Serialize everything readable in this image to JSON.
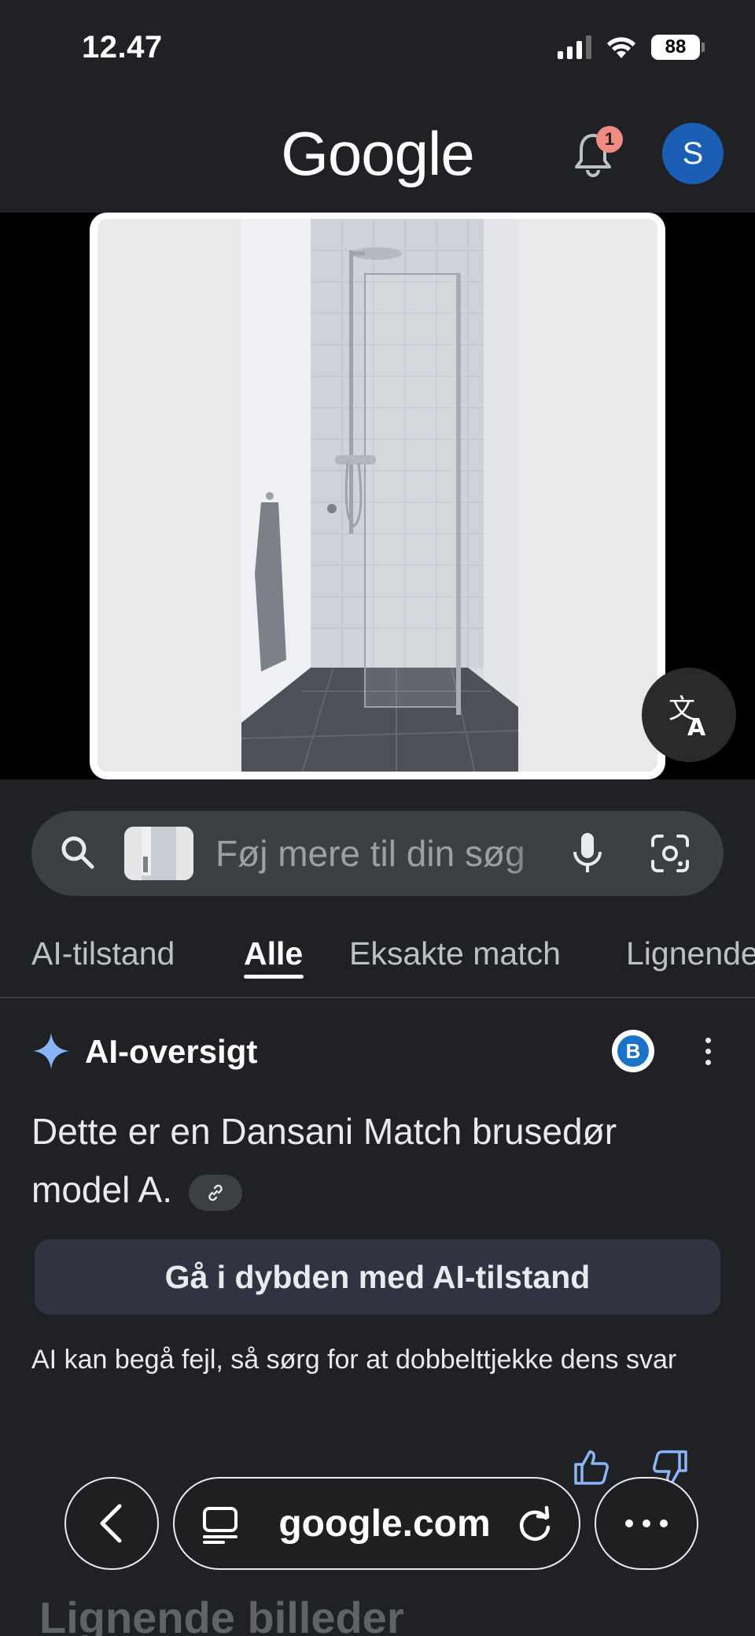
{
  "status_bar": {
    "time": "12.47",
    "battery": "88"
  },
  "header": {
    "logo": "Google",
    "notification_count": "1",
    "avatar_initial": "S"
  },
  "search": {
    "placeholder": "Føj mere til din søg"
  },
  "tabs": [
    {
      "label": "AI-tilstand"
    },
    {
      "label": "Alle"
    },
    {
      "label": "Eksakte match"
    },
    {
      "label": "Lignende"
    }
  ],
  "ai_overview": {
    "title": "AI-oversigt",
    "source_initial": "B",
    "answer": "Dette er en Dansani Match brusedør model A.",
    "deep_button": "Gå i dybden med AI-tilstand",
    "disclaimer": "AI kan begå fejl, så sørg for at dobbelttjekke dens svar"
  },
  "similar_heading": "Lignende billeder",
  "browser_bar": {
    "url": "google.com"
  },
  "colors": {
    "background": "#202124",
    "accent_blue": "#8ab4f8",
    "badge": "#f28b82",
    "avatar": "#1a5fb4"
  }
}
